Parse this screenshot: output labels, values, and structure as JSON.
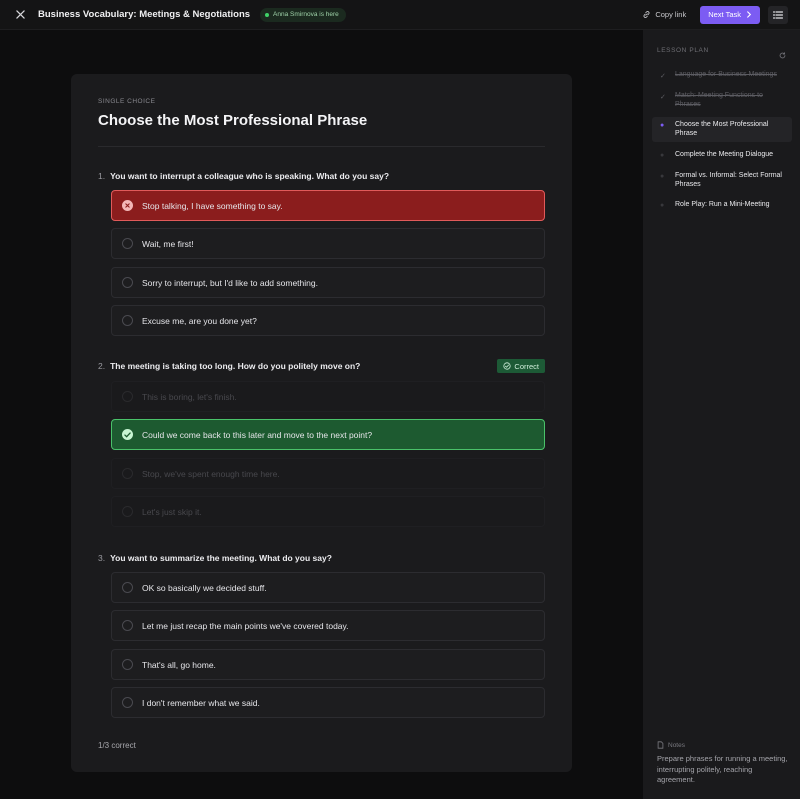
{
  "header": {
    "title": "Business Vocabulary: Meetings & Negotiations",
    "presence": "Anna Smirnova is here",
    "copy_link": "Copy link",
    "next_task": "Next Task"
  },
  "task": {
    "kind": "SINGLE CHOICE",
    "title": "Choose the Most Professional Phrase",
    "score": "1/3 correct",
    "questions": [
      {
        "number": "1.",
        "text": "You want to interrupt a colleague who is speaking. What do you say?",
        "badge": "",
        "options": [
          {
            "label": "Stop talking, I have something to say.",
            "state": "wrong"
          },
          {
            "label": "Wait, me first!",
            "state": "default"
          },
          {
            "label": "Sorry to interrupt, but I'd like to add something.",
            "state": "default"
          },
          {
            "label": "Excuse me, are you done yet?",
            "state": "default"
          }
        ]
      },
      {
        "number": "2.",
        "text": "The meeting is taking too long. How do you politely move on?",
        "badge": "Correct",
        "options": [
          {
            "label": "This is boring, let's finish.",
            "state": "faded"
          },
          {
            "label": "Could we come back to this later and move to the next point?",
            "state": "correct"
          },
          {
            "label": "Stop, we've spent enough time here.",
            "state": "faded"
          },
          {
            "label": "Let's just skip it.",
            "state": "faded"
          }
        ]
      },
      {
        "number": "3.",
        "text": "You want to summarize the meeting. What do you say?",
        "badge": "",
        "options": [
          {
            "label": "OK so basically we decided stuff.",
            "state": "default"
          },
          {
            "label": "Let me just recap the main points we've covered today.",
            "state": "default"
          },
          {
            "label": "That's all, go home.",
            "state": "default"
          },
          {
            "label": "I don't remember what we said.",
            "state": "default"
          }
        ]
      }
    ]
  },
  "sidebar": {
    "heading": "LESSON PLAN",
    "items": [
      {
        "label": "Language for Business Meetings",
        "status": "done"
      },
      {
        "label": "Match: Meeting Functions to Phrases",
        "status": "done"
      },
      {
        "label": "Choose the Most Professional Phrase",
        "status": "active"
      },
      {
        "label": "Complete the Meeting Dialogue",
        "status": "todo"
      },
      {
        "label": "Formal vs. Informal: Select Formal Phrases",
        "status": "todo"
      },
      {
        "label": "Role Play: Run a Mini-Meeting",
        "status": "todo"
      }
    ],
    "notes_heading": "Notes",
    "notes_text": "Prepare phrases for running a meeting, interrupting politely, reaching agreement."
  },
  "colors": {
    "accent": "#7c5cf3",
    "wrong": "#8b1d1d",
    "correct": "#1d5a30"
  }
}
